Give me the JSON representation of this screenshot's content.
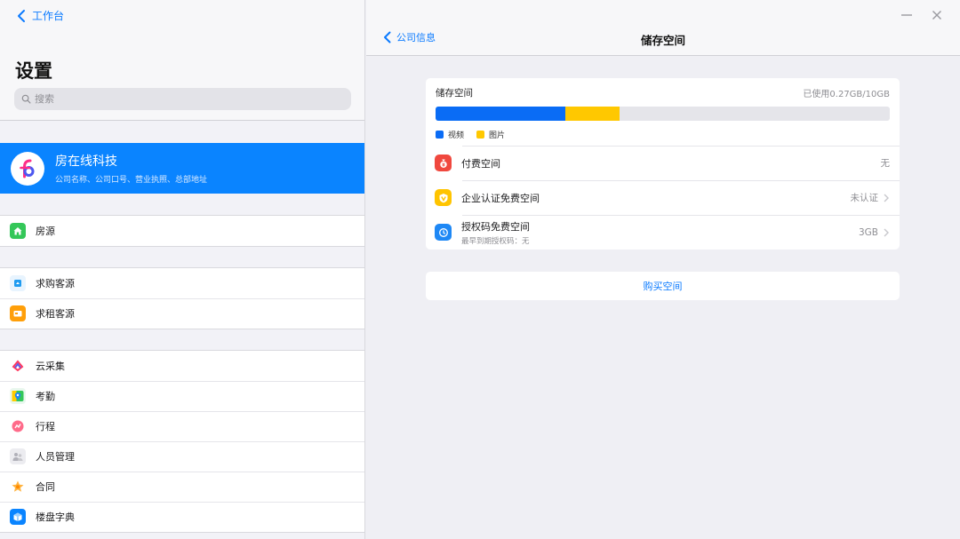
{
  "sidebar": {
    "back_label": "工作台",
    "title": "设置",
    "search_placeholder": "搜索",
    "company": {
      "name": "房在线科技",
      "desc": "公司名称、公司口号、营业执照、总部地址"
    },
    "groups": [
      {
        "items": [
          {
            "label": "房源",
            "icon": "house-icon",
            "color": "#34c759"
          }
        ]
      },
      {
        "items": [
          {
            "label": "求购客源",
            "icon": "buyer-icon",
            "color": "#1e9bf0"
          },
          {
            "label": "求租客源",
            "icon": "renter-icon",
            "color": "#ff9f0a"
          }
        ]
      },
      {
        "items": [
          {
            "label": "云采集",
            "icon": "cloud-collect-icon",
            "color": "#5e5ce6"
          },
          {
            "label": "考勤",
            "icon": "map-pin-icon",
            "color": "#34c759"
          },
          {
            "label": "行程",
            "icon": "itinerary-icon",
            "color": "#ff375f"
          },
          {
            "label": "人员管理",
            "icon": "staff-icon",
            "color": "#c7c7cc"
          },
          {
            "label": "合同",
            "icon": "contract-icon",
            "color": "#ff9500"
          },
          {
            "label": "楼盘字典",
            "icon": "building-dictionary-icon",
            "color": "#0a84ff"
          }
        ]
      }
    ]
  },
  "main": {
    "back_label": "公司信息",
    "title": "储存空间",
    "storage": {
      "heading": "储存空间",
      "usage": "已使用0.27GB/10GB",
      "segments": [
        {
          "name": "视频",
          "percent": 28.5,
          "color": "#0a6cf5"
        },
        {
          "name": "图片",
          "percent": 12,
          "color": "#ffc800"
        }
      ]
    },
    "rows": [
      {
        "title": "付费空间",
        "subtitle": "",
        "value": "无",
        "icon": "moneybag-icon",
        "color": "#f0483e",
        "chevron": false
      },
      {
        "title": "企业认证免费空间",
        "subtitle": "",
        "value": "未认证",
        "icon": "verified-v-icon",
        "color": "#ffc400",
        "chevron": true
      },
      {
        "title": "授权码免费空间",
        "subtitle": "最早到期授权码：无",
        "value": "3GB",
        "icon": "auth-code-icon",
        "color": "#1e88f5",
        "chevron": true
      }
    ],
    "buy_label": "购买空间"
  },
  "colors": {
    "accent": "#0a84ff",
    "link": "#0a7aff"
  }
}
